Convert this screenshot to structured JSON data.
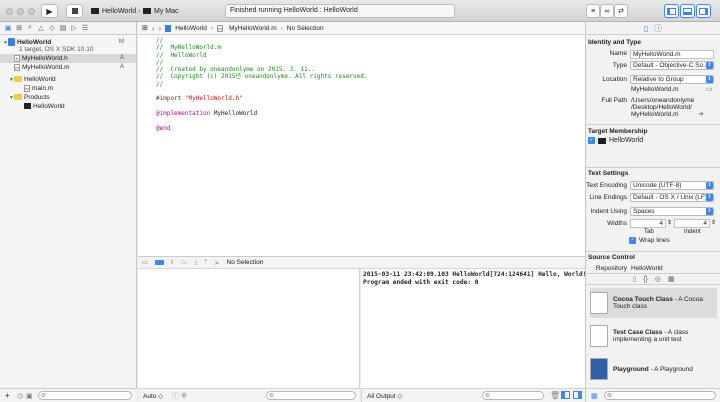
{
  "toolbar": {
    "scheme": "HelloWorld",
    "destination": "My Mac",
    "status": "Finished running HelloWorld : HelloWorld"
  },
  "navigator": {
    "project": {
      "name": "HelloWorld",
      "subtitle": "1 target, OS X SDK 10.10",
      "flag": "M"
    },
    "files": [
      {
        "name": "MyHelloWorld.h",
        "flag": "A"
      },
      {
        "name": "MyHelloWorld.m",
        "flag": "A"
      }
    ],
    "groups": [
      {
        "name": "HelloWorld",
        "children": [
          "main.m"
        ]
      },
      {
        "name": "Products",
        "children": [
          "HelloWorld"
        ]
      }
    ]
  },
  "jumpbar": {
    "crumbs": [
      "HelloWorld",
      "MyHelloWorld.m",
      "No Selection"
    ]
  },
  "code": {
    "comments": [
      "//",
      "//  MyHelloWorld.m",
      "//  HelloWorld",
      "//",
      "//  Created by oneandonlyme on 2015. 3. 11..",
      "//  Copyright (c) 2015년 oneandonlyme. All rights reserved.",
      "//"
    ],
    "import_kw": "#import",
    "import_str": "\"MyHelloWorld.h\"",
    "impl_kw": "@implementation",
    "impl_name": "MyHelloWorld",
    "end_kw": "@end"
  },
  "debug": {
    "selection": "No Selection",
    "vars_scope": "Auto ◇",
    "console_filter": "All Output ◇",
    "console_lines": [
      "2015-03-11 23:42:09.103 HelloWorld[724:124641] Hello, World!",
      "Program ended with exit code: 0"
    ]
  },
  "inspector": {
    "identity_title": "Identity and Type",
    "name_label": "Name",
    "name_value": "MyHelloWorld.m",
    "type_label": "Type",
    "type_value": "Default - Objective-C So...",
    "location_label": "Location",
    "location_value": "Relative to Group",
    "location_file": "MyHelloWorld.m",
    "fullpath_label": "Full Path",
    "fullpath_lines": [
      "/Users/oneandonlyme",
      "/Desktop/HelloWorld/",
      "MyHelloWorld.m"
    ],
    "target_title": "Target Membership",
    "target_name": "HelloWorld",
    "text_title": "Text Settings",
    "encoding_label": "Text Encoding",
    "encoding_value": "Unicode (UTF-8)",
    "endings_label": "Line Endings",
    "endings_value": "Default - OS X / Unix (LF)",
    "indent_label": "Indent Using",
    "indent_value": "Spaces",
    "widths_label": "Widths",
    "tab_width": "4",
    "indent_width": "4",
    "tab_label": "Tab",
    "indent_sub_label": "Indent",
    "wrap_label": "Wrap lines",
    "source_title": "Source Control",
    "repo_label": "Repository",
    "repo_value": "HelloWorld",
    "templates": [
      {
        "title": "Cocoa Touch Class",
        "desc": " - A Cocoa Touch class"
      },
      {
        "title": "Test Case Class",
        "desc": " - A class implementing a unit test"
      },
      {
        "title": "Playground",
        "desc": " - A Playground"
      }
    ]
  },
  "colors": {
    "accent": "#3d86f0",
    "comment": "#1d8a1b",
    "string": "#c41a16",
    "keyword": "#aa0d91"
  }
}
